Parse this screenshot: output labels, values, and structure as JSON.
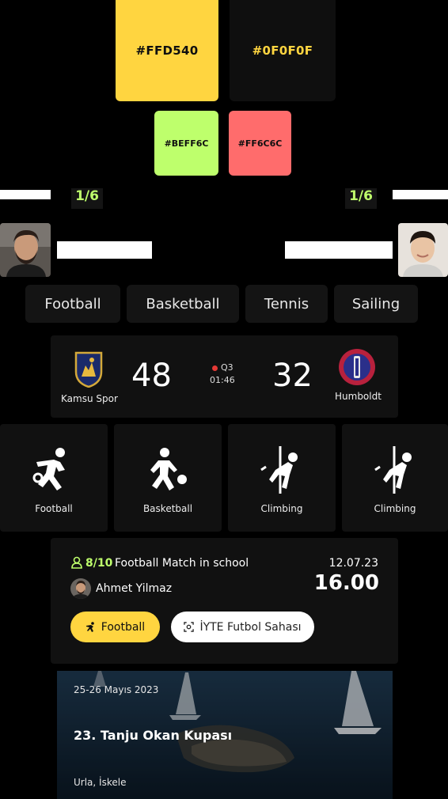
{
  "palette": {
    "primary": {
      "label": "#FFD540",
      "color": "#FFD540",
      "text_color": "#0F0F0F"
    },
    "background": {
      "label": "#0F0F0F",
      "color": "#0F0F0F",
      "text_color": "#FFD540"
    },
    "success": {
      "label": "#BEFF6C",
      "color": "#BEFF6C",
      "text_color": "#0F0F0F"
    },
    "danger": {
      "label": "#FF6C6C",
      "color": "#FF6C6C",
      "text_color": "#0F0F0F"
    }
  },
  "matchup": {
    "left_score": "1/6",
    "right_score": "1/6",
    "left_player_icon": "avatar-man-beard",
    "right_player_icon": "avatar-young-man"
  },
  "tabs": [
    {
      "label": "Football"
    },
    {
      "label": "Basketball"
    },
    {
      "label": "Tennis"
    },
    {
      "label": "Sailing"
    }
  ],
  "scoreboard": {
    "home": {
      "name": "Kamsu Spor",
      "score": "48",
      "logo_icon": "shield-crest-icon"
    },
    "away": {
      "name": "Humboldt",
      "score": "32",
      "logo_icon": "round-club-badge-icon"
    },
    "period": "Q3",
    "clock": "01:46",
    "live_color": "#E53935"
  },
  "sports": [
    {
      "label": "Football",
      "icon": "football-player-icon"
    },
    {
      "label": "Basketball",
      "icon": "basketball-player-icon"
    },
    {
      "label": "Climbing",
      "icon": "climbing-icon"
    },
    {
      "label": "Climbing",
      "icon": "climbing-icon"
    }
  ],
  "match": {
    "participants": "8/10",
    "title": "Football Match in school",
    "date": "12.07.23",
    "time": "16.00",
    "organizer": "Ahmet Yilmaz",
    "sport_pill": "Football",
    "location_pill": "İYTE Futbol Sahası",
    "accent": "#FFD540",
    "count_color": "#BEFF6C"
  },
  "event": {
    "date": "25-26 Mayıs 2023",
    "title": "23. Tanju Okan Kupası",
    "location": "Urla, İskele"
  }
}
